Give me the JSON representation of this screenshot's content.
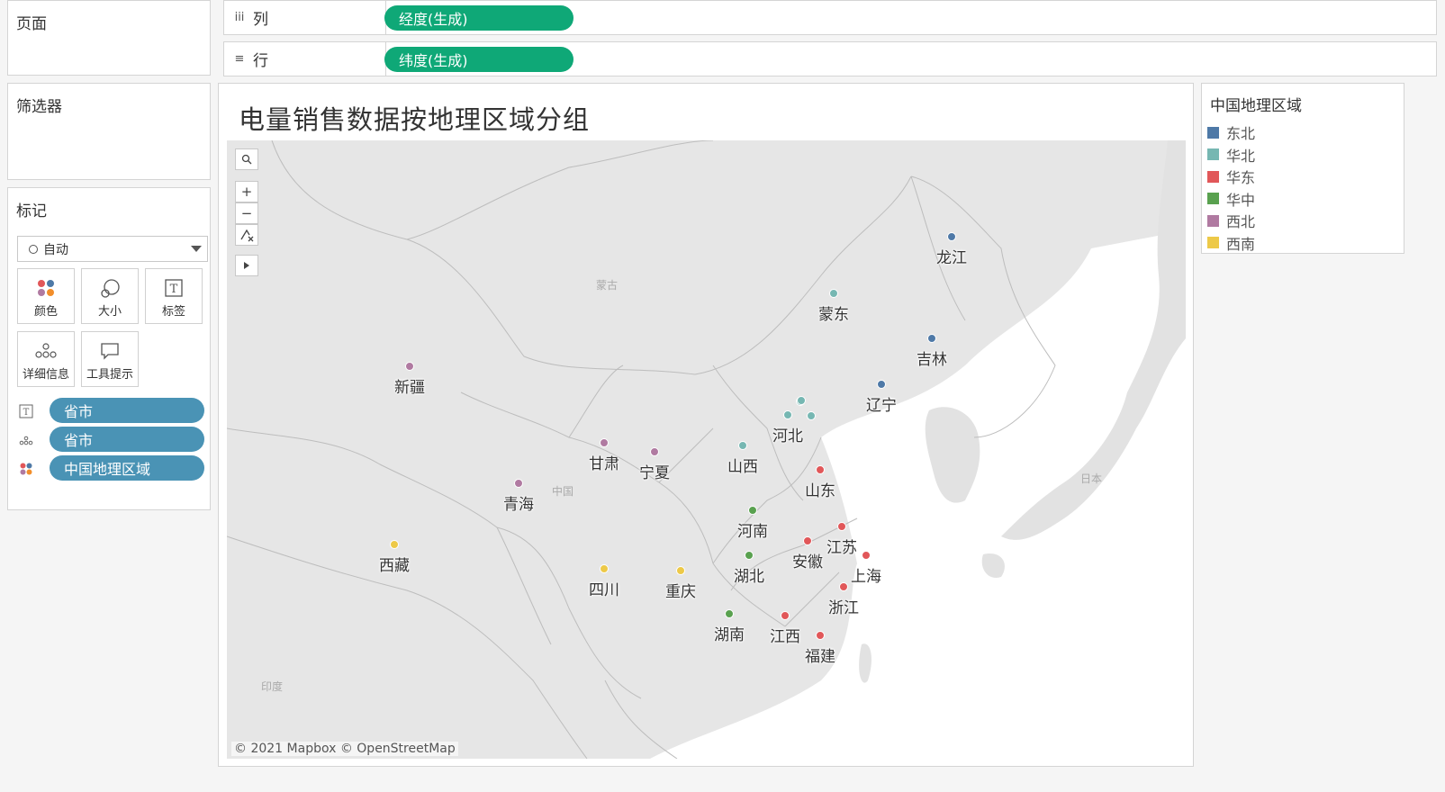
{
  "panes": {
    "pages_title": "页面",
    "filters_title": "筛选器",
    "marks_title": "标记"
  },
  "shelves": {
    "columns": {
      "icon": "iii",
      "label": "列",
      "pill": "经度(生成)"
    },
    "rows": {
      "icon": "≡",
      "label": "行",
      "pill": "纬度(生成)"
    }
  },
  "marks": {
    "type_selected": "自动",
    "buttons": {
      "color": "颜色",
      "size": "大小",
      "label": "标签",
      "detail": "详细信息",
      "tooltip": "工具提示"
    },
    "fields": [
      {
        "icon": "label-icon",
        "name": "省市"
      },
      {
        "icon": "detail-icon",
        "name": "省市"
      },
      {
        "icon": "color-icon",
        "name": "中国地理区域"
      }
    ]
  },
  "view": {
    "title": "电量销售数据按地理区域分组",
    "attribution": "© 2021 Mapbox © OpenStreetMap",
    "basemap_labels": {
      "mongolia": "蒙古",
      "china": "中国",
      "japan": "日本",
      "india": "印度"
    }
  },
  "legend": {
    "title": "中国地理区域",
    "items": [
      {
        "name": "东北",
        "color": "#4e79a7"
      },
      {
        "name": "华北",
        "color": "#76b7b2"
      },
      {
        "name": "华东",
        "color": "#e15759"
      },
      {
        "name": "华中",
        "color": "#59a14f"
      },
      {
        "name": "西北",
        "color": "#b07aa1"
      },
      {
        "name": "西南",
        "color": "#edc948"
      }
    ]
  },
  "chart_data": {
    "type": "scatter",
    "title": "电量销售数据按地理区域分组",
    "points": [
      {
        "label": "龙江",
        "region": "东北"
      },
      {
        "label": "吉林",
        "region": "东北"
      },
      {
        "label": "辽宁",
        "region": "东北"
      },
      {
        "label": "蒙东",
        "region": "华北"
      },
      {
        "label": "河北",
        "region": "华北"
      },
      {
        "label": "",
        "region": "华北"
      },
      {
        "label": "",
        "region": "华北"
      },
      {
        "label": "",
        "region": "华北"
      },
      {
        "label": "山西",
        "region": "华北"
      },
      {
        "label": "山东",
        "region": "华东"
      },
      {
        "label": "江苏",
        "region": "华东"
      },
      {
        "label": "安徽",
        "region": "华东"
      },
      {
        "label": "上海",
        "region": "华东"
      },
      {
        "label": "浙江",
        "region": "华东"
      },
      {
        "label": "江西",
        "region": "华东"
      },
      {
        "label": "福建",
        "region": "华东"
      },
      {
        "label": "河南",
        "region": "华中"
      },
      {
        "label": "湖北",
        "region": "华中"
      },
      {
        "label": "湖南",
        "region": "华中"
      },
      {
        "label": "新疆",
        "region": "西北"
      },
      {
        "label": "甘肃",
        "region": "西北"
      },
      {
        "label": "宁夏",
        "region": "西北"
      },
      {
        "label": "青海",
        "region": "西北"
      },
      {
        "label": "西藏",
        "region": "西南"
      },
      {
        "label": "四川",
        "region": "西南"
      },
      {
        "label": "重庆",
        "region": "西南"
      }
    ]
  }
}
